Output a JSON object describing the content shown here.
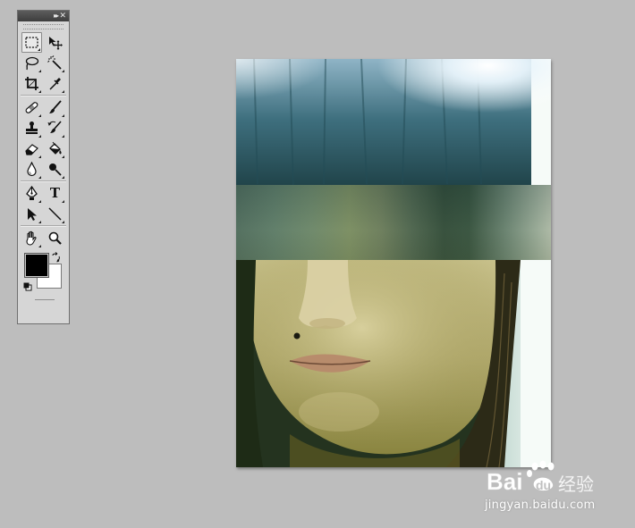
{
  "tools_panel": {
    "collapse_glyph": "▸▸",
    "close_glyph": "✕",
    "selected_tool": "rectangular-marquee",
    "tools": [
      {
        "id": "rectangular-marquee",
        "icon": "marquee-icon"
      },
      {
        "id": "move",
        "icon": "move-icon"
      },
      {
        "id": "lasso",
        "icon": "lasso-icon"
      },
      {
        "id": "magic-wand",
        "icon": "magic-wand-icon"
      },
      {
        "id": "crop",
        "icon": "crop-icon"
      },
      {
        "id": "eyedropper",
        "icon": "eyedropper-icon"
      },
      {
        "id": "healing-brush",
        "icon": "bandage-icon"
      },
      {
        "id": "brush",
        "icon": "brush-icon"
      },
      {
        "id": "clone-stamp",
        "icon": "stamp-icon"
      },
      {
        "id": "history-brush",
        "icon": "history-brush-icon"
      },
      {
        "id": "eraser",
        "icon": "eraser-icon"
      },
      {
        "id": "paint-bucket",
        "icon": "paint-bucket-icon"
      },
      {
        "id": "blur",
        "icon": "drop-icon"
      },
      {
        "id": "dodge",
        "icon": "dodge-icon"
      },
      {
        "id": "pen",
        "icon": "pen-icon"
      },
      {
        "id": "type",
        "icon": "type-icon",
        "glyph": "T"
      },
      {
        "id": "path-selection",
        "icon": "arrow-icon"
      },
      {
        "id": "line",
        "icon": "line-icon"
      },
      {
        "id": "hand",
        "icon": "hand-icon"
      },
      {
        "id": "zoom",
        "icon": "magnifier-icon"
      }
    ],
    "colors": {
      "foreground": "#000000",
      "background": "#ffffff"
    }
  },
  "canvas": {
    "background": "#bdbdbd"
  },
  "watermark": {
    "brand": "Bai du 经验",
    "url": "jingyan.baidu.com"
  }
}
